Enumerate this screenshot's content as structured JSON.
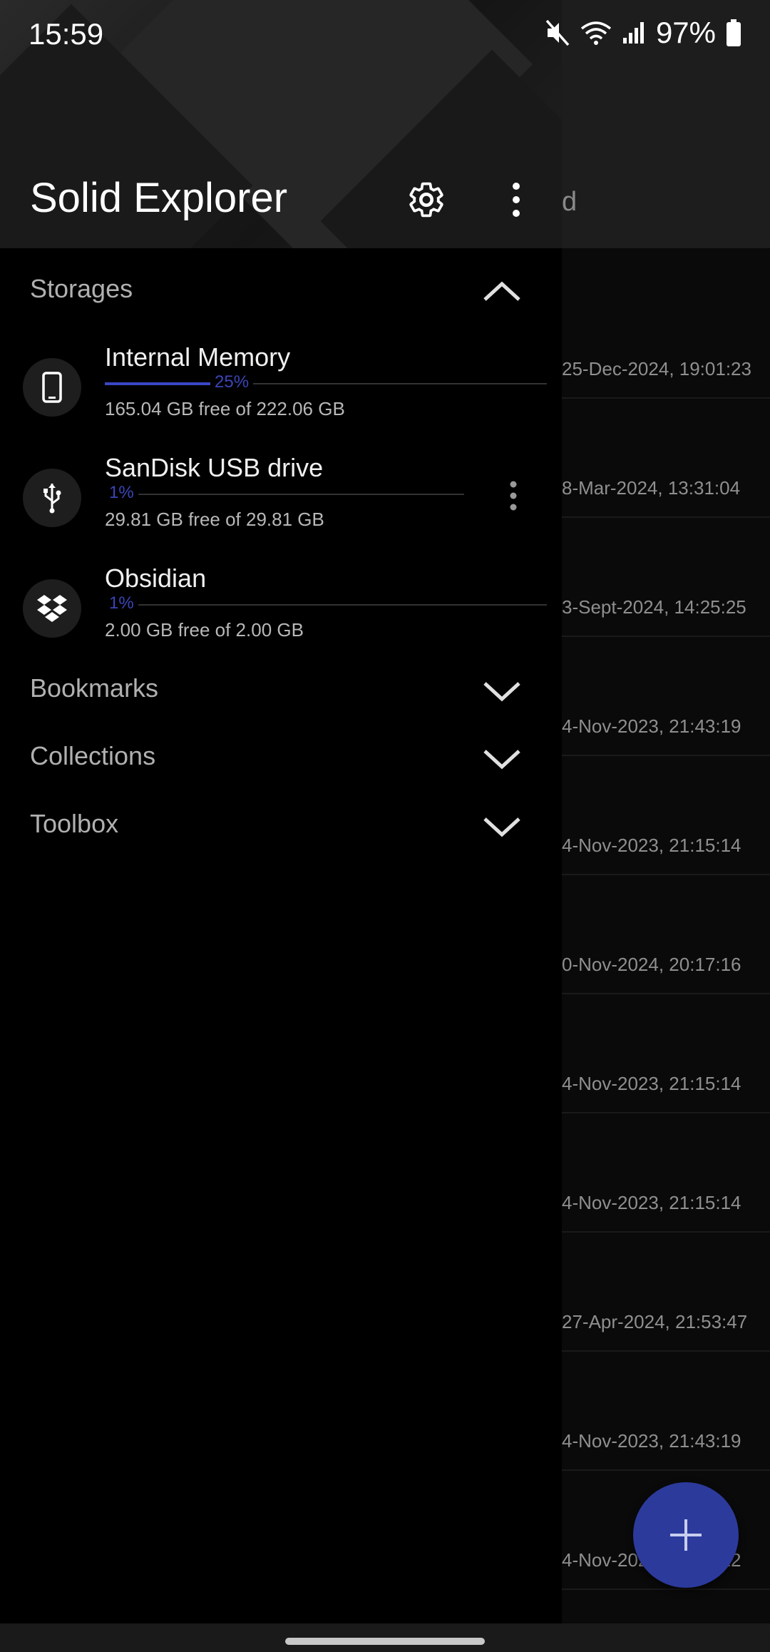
{
  "status_bar": {
    "time": "15:59",
    "battery": "97%"
  },
  "drawer": {
    "title": "Solid Explorer",
    "sections": {
      "storages": "Storages",
      "bookmarks": "Bookmarks",
      "collections": "Collections",
      "toolbox": "Toolbox"
    },
    "storages": [
      {
        "name": "Internal Memory",
        "percent_label": "25%",
        "used_fraction": 0.25,
        "free_text": "165.04 GB free of 222.06 GB",
        "icon": "phone-icon"
      },
      {
        "name": "SanDisk USB drive",
        "percent_label": "1%",
        "used_fraction": 0.01,
        "free_text": "29.81 GB free of 29.81 GB",
        "icon": "usb-icon"
      },
      {
        "name": "Obsidian",
        "percent_label": "1%",
        "used_fraction": 0.01,
        "free_text": "2.00 GB free of 2.00 GB",
        "icon": "dropbox-icon"
      }
    ]
  },
  "background_list": {
    "header_fragment": "d",
    "dates": [
      "25-Dec-2024, 19:01:23",
      "8-Mar-2024, 13:31:04",
      "3-Sept-2024, 14:25:25",
      "4-Nov-2023, 21:43:19",
      "4-Nov-2023, 21:15:14",
      "0-Nov-2024, 20:17:16",
      "4-Nov-2023, 21:15:14",
      "4-Nov-2023, 21:15:14",
      "27-Apr-2024, 21:53:47",
      "4-Nov-2023, 21:43:19",
      "4-Nov-2023, 21:15:12"
    ]
  },
  "colors": {
    "accent": "#3a47c5",
    "fab": "#2c3a9c",
    "background": "#000000"
  }
}
